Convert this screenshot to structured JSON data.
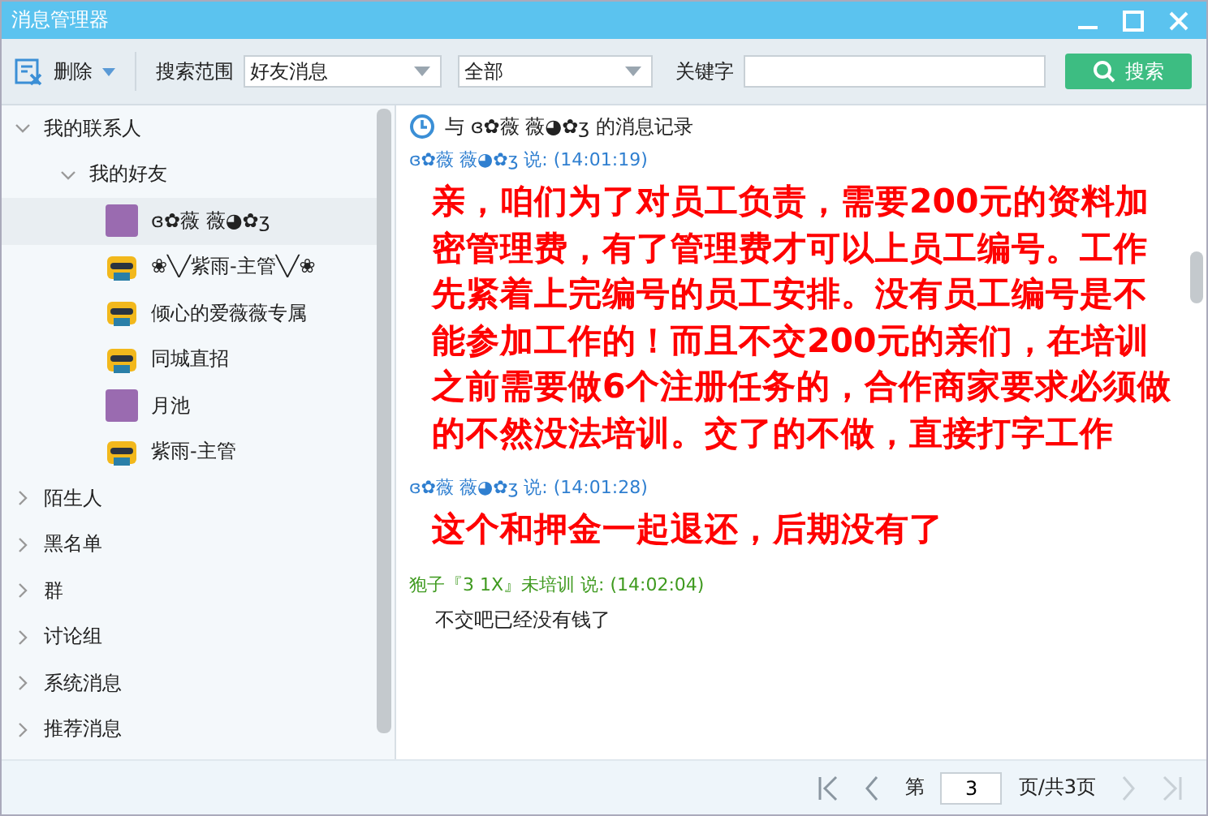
{
  "window": {
    "title": "消息管理器"
  },
  "toolbar": {
    "delete_label": "删除",
    "scope_label": "搜索范围",
    "scope_value": "好友消息",
    "range_value": "全部",
    "keyword_label": "关键字",
    "search_label": "搜索"
  },
  "sidebar": {
    "items": [
      {
        "label": "我的联系人",
        "expanded": true,
        "children": [
          {
            "label": "我的好友",
            "expanded": true,
            "children": [
              {
                "label": "ɞ✿薇 薇◕✿ʒ",
                "kind": "photo",
                "selected": true
              },
              {
                "label": "❀╲╱紫雨-主管╲╱❀",
                "kind": "robot",
                "selected": false
              },
              {
                "label": "倾心的爱薇薇专属",
                "kind": "robot",
                "selected": false
              },
              {
                "label": "同城直招",
                "kind": "robot",
                "selected": false
              },
              {
                "label": "月池",
                "kind": "photo",
                "selected": false
              },
              {
                "label": "紫雨-主管",
                "kind": "robot",
                "selected": false
              }
            ]
          }
        ]
      },
      {
        "label": "陌生人",
        "expanded": false
      },
      {
        "label": "黑名单",
        "expanded": false
      },
      {
        "label": "群",
        "expanded": false
      },
      {
        "label": "讨论组",
        "expanded": false
      },
      {
        "label": "系统消息",
        "expanded": false
      },
      {
        "label": "推荐消息",
        "expanded": false
      }
    ]
  },
  "history": {
    "title": "与 ɞ✿薇 薇◕✿ʒ 的消息记录",
    "messages": [
      {
        "sender": "ɞ✿薇 薇◕✿ʒ 说: (14:01:19)",
        "color": "#2f7fd0",
        "kind": "big",
        "text": "亲，咱们为了对员工负责，需要200元的资料加密管理费，有了管理费才可以上员工编号。工作先紧着上完编号的员工安排。没有员工编号是不能参加工作的！而且不交200元的亲们，在培训之前需要做6个注册任务的，合作商家要求必须做的不然没法培训。交了的不做，直接打字工作"
      },
      {
        "sender": "ɞ✿薇 薇◕✿ʒ 说: (14:01:28)",
        "color": "#2f7fd0",
        "kind": "big",
        "text": "这个和押金一起退还，后期没有了"
      },
      {
        "sender": "狍子『3 1X』未培训 说: (14:02:04)",
        "color": "#3f9a1f",
        "kind": "normal",
        "text": "不交吧已经没有钱了"
      }
    ]
  },
  "pager": {
    "page_label": "第",
    "page_value": "3",
    "total_label": "页/共3页"
  }
}
